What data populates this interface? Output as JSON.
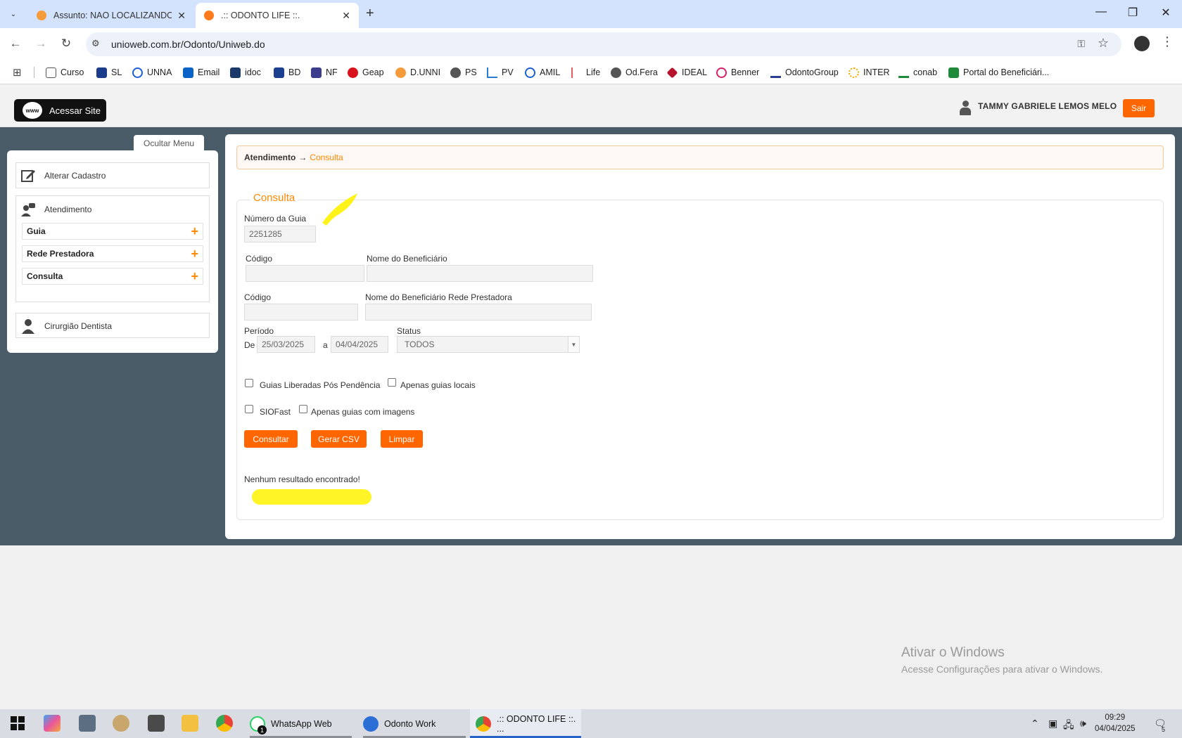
{
  "browser": {
    "tabs": [
      {
        "title": "Assunto: NAO LOCALIZANDO GUIA"
      },
      {
        "title": ".:: ODONTO LIFE ::."
      }
    ],
    "url": "unioweb.com.br/Odonto/Uniweb.do",
    "bookmarks": [
      "Curso",
      "SL",
      "UNNA",
      "Email",
      "idoc",
      "BD",
      "NF",
      "Geap",
      "D.UNNI",
      "PS",
      "PV",
      "AMIL",
      "Life",
      "Od.Fera",
      "IDEAL",
      "Benner",
      "OdontoGroup",
      "INTER",
      "conab",
      "Portal do Beneficiári..."
    ]
  },
  "header": {
    "acessar_site": "Acessar Site",
    "www": "www",
    "user_name": "TAMMY GABRIELE LEMOS MELO",
    "logout": "Sair"
  },
  "sidebar": {
    "toggle": "Ocultar Menu",
    "alterar_cadastro": "Alterar Cadastro",
    "atendimento": "Atendimento",
    "submenu": [
      "Guia",
      "Rede Prestadora",
      "Consulta"
    ],
    "cirurgiao": "Cirurgião Dentista"
  },
  "breadcrumb": {
    "parent": "Atendimento",
    "arrow": "→",
    "current": "Consulta"
  },
  "form": {
    "legend": "Consulta",
    "numero_guia_label": "Número da Guia",
    "numero_guia_value": "2251285",
    "codigo_label": "Código",
    "nome_beneficiario_label": "Nome do Beneficiário",
    "codigo2_label": "Código",
    "nome_rede_label": "Nome do Beneficiário Rede Prestadora",
    "periodo_label": "Período",
    "de_label": "De",
    "data_inicio": "25/03/2025",
    "a_label": "a",
    "data_fim": "04/04/2025",
    "status_label": "Status",
    "status_value": "TODOS",
    "chk_liberadas": "Guias Liberadas Pós Pendência",
    "chk_locais": "Apenas guias locais",
    "chk_siofast": "SIOFast",
    "chk_imagens": "Apenas guias com imagens",
    "btn_consultar": "Consultar",
    "btn_csv": "Gerar CSV",
    "btn_limpar": "Limpar",
    "result": "Nenhum resultado encontrado!"
  },
  "watermark": {
    "line1": "Ativar o Windows",
    "line2": "Acesse Configurações para ativar o Windows."
  },
  "taskbar": {
    "apps": [
      "WhatsApp Web",
      "Odonto Work",
      ".:: ODONTO LIFE ::. ..."
    ],
    "whatsapp_badge": "1",
    "time": "09:29",
    "date": "04/04/2025",
    "notif_count": "5"
  },
  "colors": {
    "accent": "#ff6600",
    "accent_text": "#ff8800",
    "main_bg": "#4a5b68",
    "highlight": "#fff200"
  }
}
